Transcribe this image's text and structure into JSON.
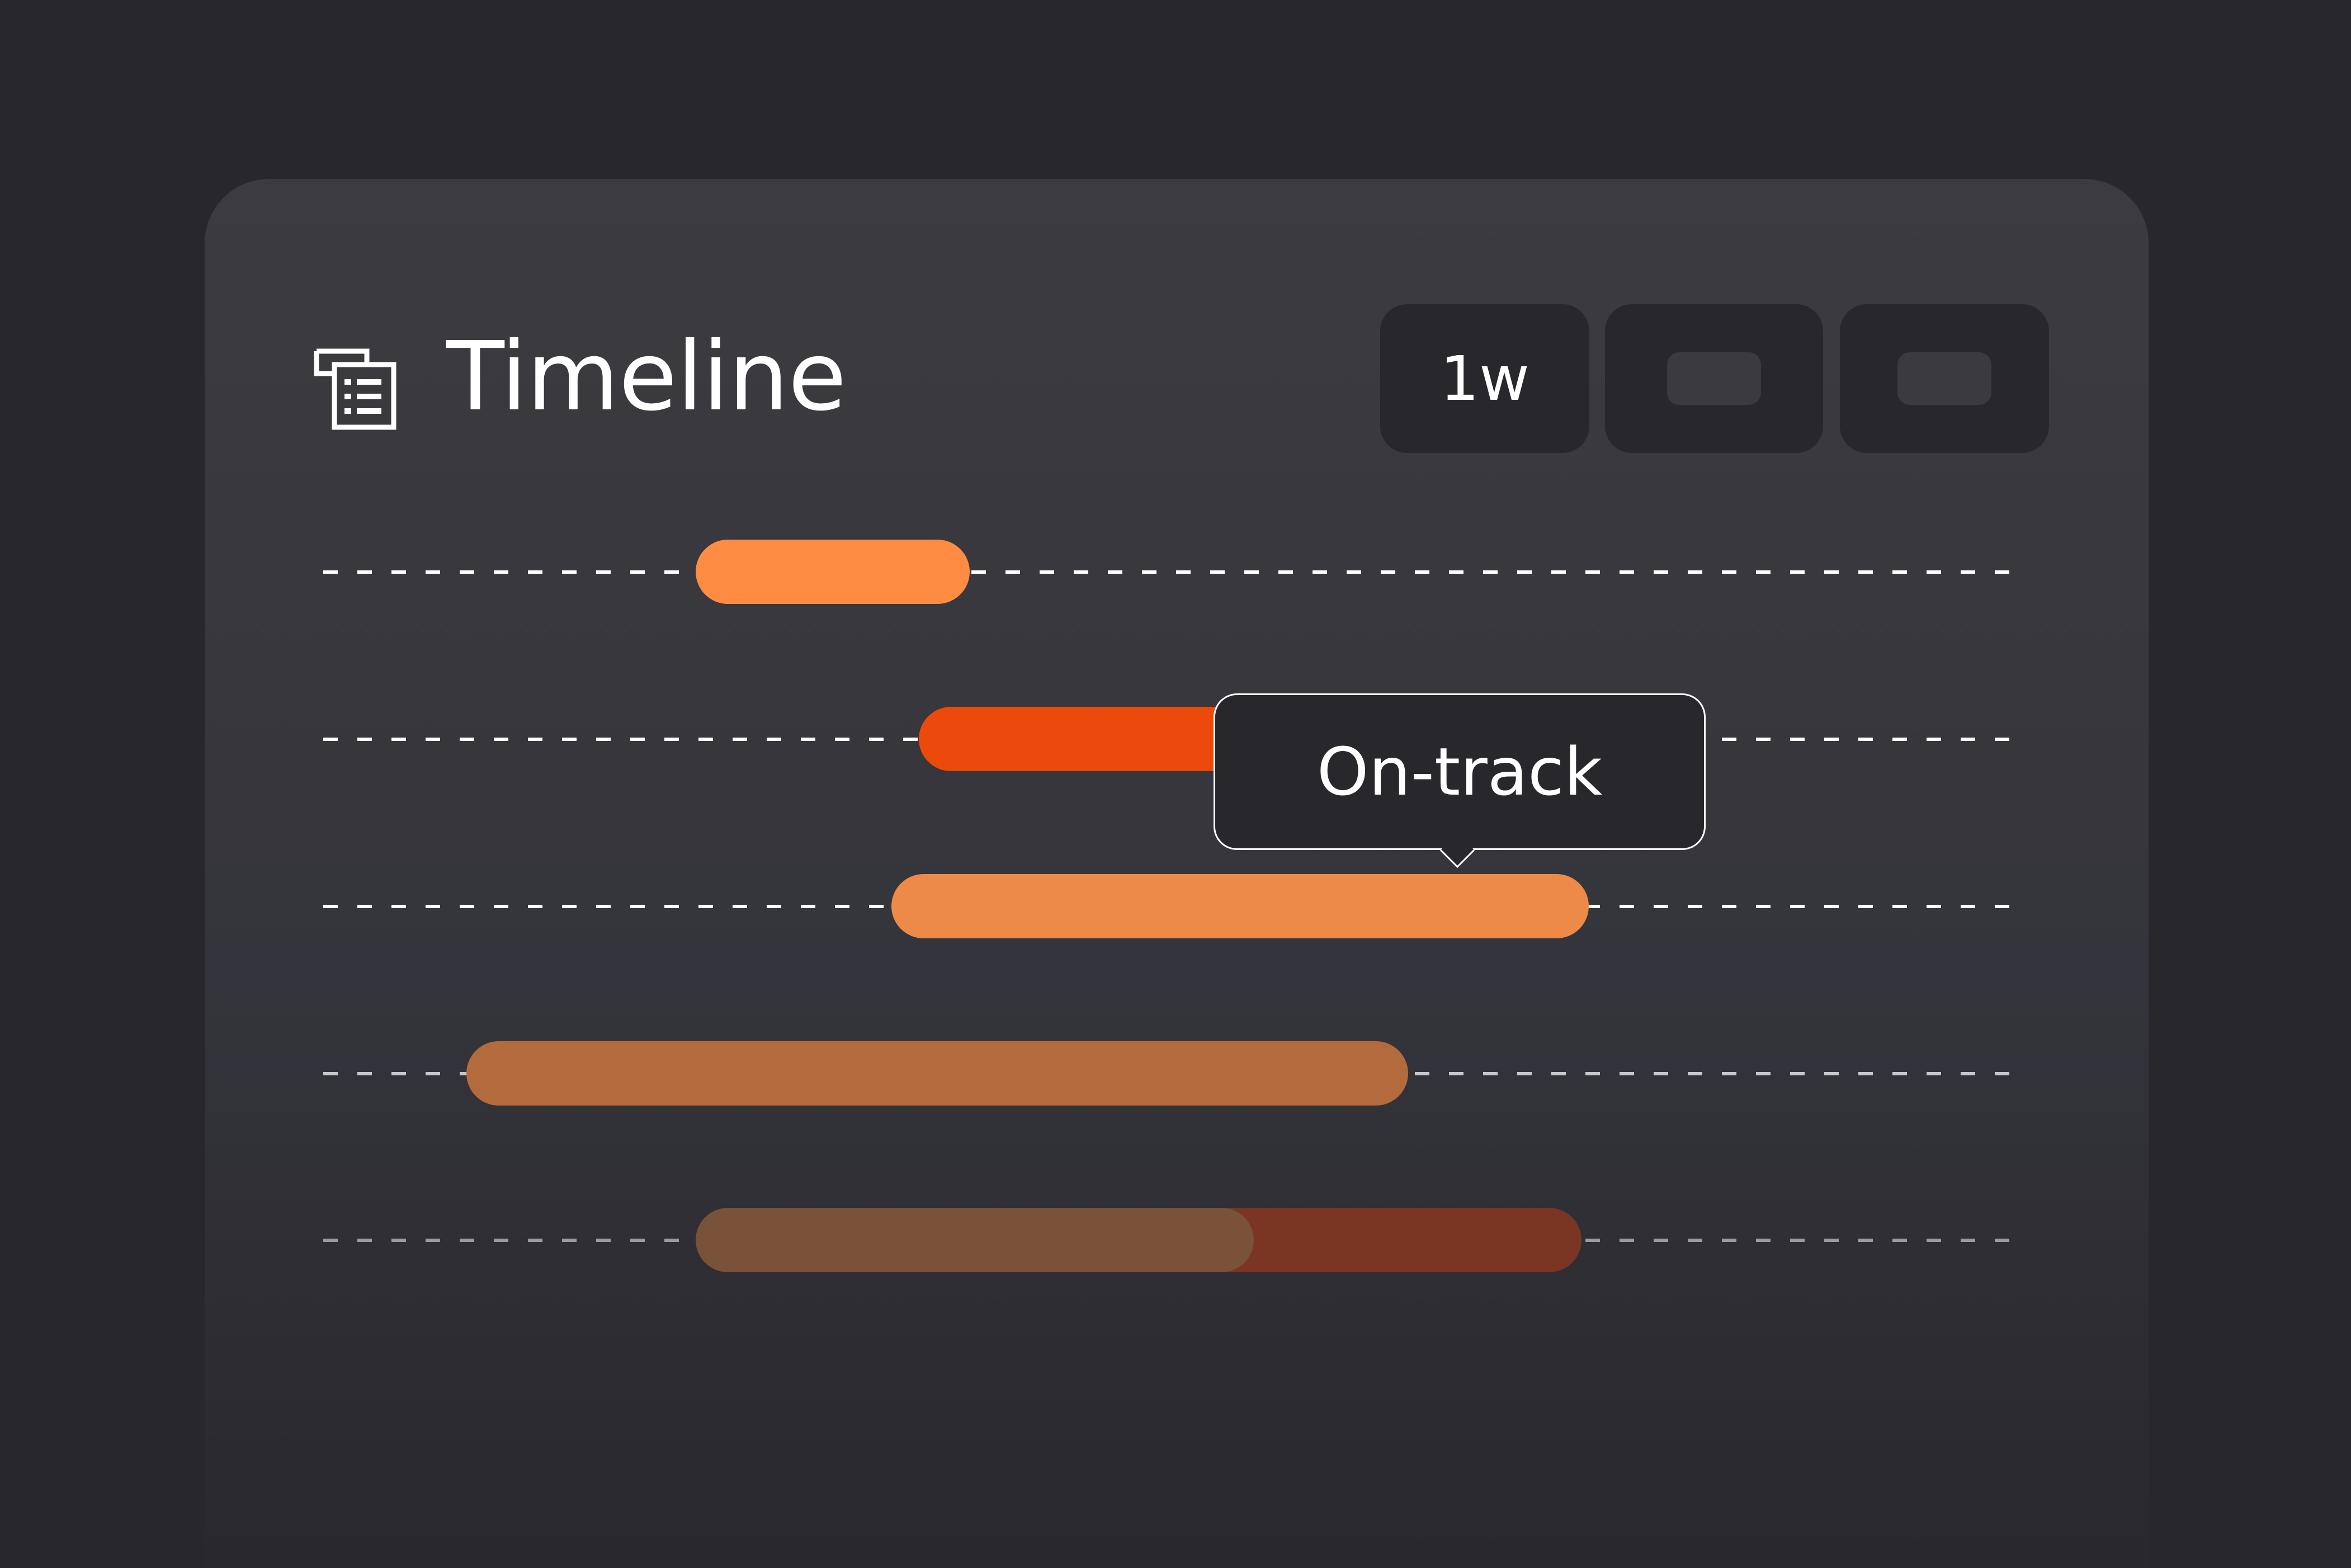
{
  "header": {
    "title": "Timeline",
    "icon": "document-list-icon"
  },
  "range_buttons": [
    {
      "label": "1w",
      "selected": true
    },
    {
      "label": "",
      "placeholder": true
    },
    {
      "label": "",
      "placeholder": true
    }
  ],
  "tooltip": {
    "text": "On-track"
  },
  "timeline_rows": [
    {
      "bar_color": "#ff8c42"
    },
    {
      "bar_color": "#eb4a0a"
    },
    {
      "bar_color": "#ee8a48"
    },
    {
      "bar_color": "#b36b3e"
    },
    {
      "bar_color": "#7a5239",
      "progress_color": "#7a3622"
    }
  ],
  "colors": {
    "background": "#27272c",
    "card": "#3b3b40",
    "accent": "#ff8c42"
  }
}
